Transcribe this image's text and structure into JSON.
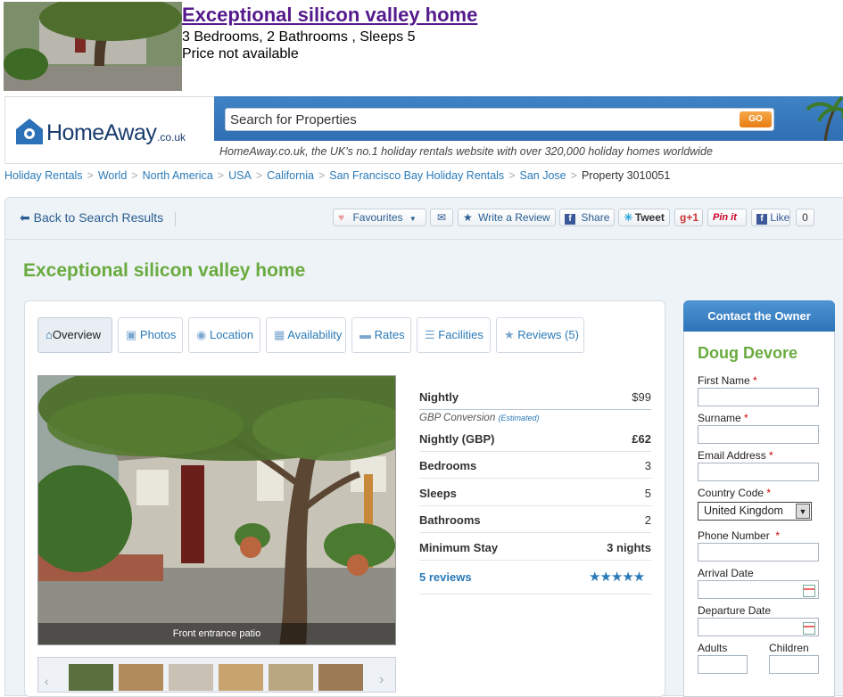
{
  "listing_strip": {
    "title": "Exceptional silicon valley home",
    "line1": "3 Bedrooms, 2 Bathrooms , Sleeps 5",
    "line2": "Price not available"
  },
  "header": {
    "logo_main": "HomeAway",
    "logo_suffix": ".co.uk",
    "search_placeholder": "Search for Properties",
    "go_label": "GO",
    "tagline": "HomeAway.co.uk, the UK's no.1 holiday rentals website with over 320,000 holiday homes worldwide"
  },
  "breadcrumb": [
    "Holiday Rentals",
    "World",
    "North America",
    "USA",
    "California",
    "San Francisco Bay Holiday Rentals",
    "San Jose"
  ],
  "breadcrumb_current": "Property 3010051",
  "toolbar": {
    "back": "Back to Search Results",
    "favourites": "Favourites",
    "write_review": "Write a Review",
    "share": "Share",
    "tweet": "Tweet",
    "gplus": "+1",
    "pinit": "Pin it",
    "like": "Like",
    "like_count": "0"
  },
  "property": {
    "title": "Exceptional silicon valley home"
  },
  "tabs": [
    {
      "label": "Overview",
      "icon": "home-icon"
    },
    {
      "label": "Photos",
      "icon": "photo-icon"
    },
    {
      "label": "Location",
      "icon": "map-pin-icon"
    },
    {
      "label": "Availability",
      "icon": "calendar-icon"
    },
    {
      "label": "Rates",
      "icon": "card-icon"
    },
    {
      "label": "Facilities",
      "icon": "list-icon"
    },
    {
      "label": "Reviews (5)",
      "icon": "star-icon"
    }
  ],
  "photo": {
    "caption": "Front entrance patio"
  },
  "rates": {
    "nightly_label": "Nightly",
    "nightly_value": "$99",
    "gbp_note": "GBP Conversion",
    "gbp_estimated": "(Estimated)",
    "nightly_gbp_label": "Nightly (GBP)",
    "nightly_gbp_value": "£62",
    "bedrooms_label": "Bedrooms",
    "bedrooms_value": "3",
    "sleeps_label": "Sleeps",
    "sleeps_value": "5",
    "bathrooms_label": "Bathrooms",
    "bathrooms_value": "2",
    "min_stay_label": "Minimum Stay",
    "min_stay_value": "3 nights",
    "reviews_link": "5 reviews",
    "rating_stars": 5
  },
  "contact": {
    "header": "Contact the Owner",
    "owner": "Doug Devore",
    "first_name": "First Name",
    "surname": "Surname",
    "email": "Email Address",
    "country_code": "Country Code",
    "country_value": "United Kingdom",
    "phone": "Phone Number",
    "arrival": "Arrival Date",
    "departure": "Departure Date",
    "adults": "Adults",
    "children": "Children",
    "required_mark": "*"
  }
}
